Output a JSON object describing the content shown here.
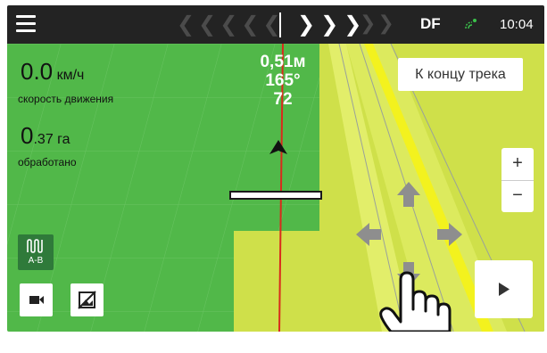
{
  "topbar": {
    "menu_icon": "hamburger-menu-icon",
    "chevrons_left": "❮❮❮❮❮",
    "chevrons_active": "❯❯❯",
    "chevrons_right": "❯❯",
    "profile": "DF",
    "gps_icon": "satellite-signal-icon",
    "time": "10:04"
  },
  "stats": {
    "speed_value": "0.0",
    "speed_unit": "км/ч",
    "speed_label": "скорость движения",
    "area_value": "0",
    "area_decimal": ".37",
    "area_unit": "га",
    "area_label": "обработано"
  },
  "guidance": {
    "offset": "0,51м",
    "heading": "165°",
    "line_number": "72"
  },
  "buttons": {
    "to_track_end": "К концу трека",
    "zoom_in": "+",
    "zoom_out": "−",
    "ab_label": "A-B",
    "ab_icon": "ab-line-icon",
    "camera_icon": "video-camera-icon",
    "no_image_icon": "image-off-icon",
    "play_icon": "play-icon",
    "pan_icons": [
      "arrow-up-icon",
      "arrow-left-icon",
      "arrow-right-icon",
      "arrow-down-icon"
    ]
  },
  "colors": {
    "field_green": "#51b849",
    "worked_yellow": "#d6e64a",
    "path_line": "#d92b1c",
    "topbar": "#232323"
  }
}
